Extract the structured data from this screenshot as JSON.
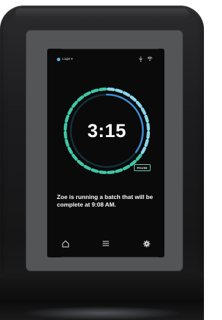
{
  "status_bar": {
    "login_label": "Login ▾",
    "login_dot_color": "#58b4e8",
    "icons": [
      "usb-icon",
      "wifi-icon"
    ]
  },
  "timer": {
    "time": "3:15",
    "ring_colors": {
      "elapsed": "#3fc7a6",
      "remaining": "#8ad8ea",
      "progress_arc": "#3e8fd6"
    },
    "progress": 0.35
  },
  "pause_label": "PAUSE",
  "message": "Zoe is running a batch that will be complete at 9:08 AM.",
  "nav": {
    "items": [
      "home-icon",
      "menu-icon",
      "settings-icon"
    ]
  }
}
